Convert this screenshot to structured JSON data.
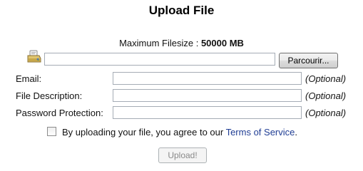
{
  "page": {
    "title": "Upload File"
  },
  "max_filesize": {
    "label": "Maximum Filesize : ",
    "value": "50000 MB"
  },
  "file_picker": {
    "icon": "file-drive-icon",
    "path_value": "",
    "browse_label": "Parcourir..."
  },
  "form": {
    "email": {
      "label": "Email:",
      "value": "",
      "hint": "(Optional)"
    },
    "description": {
      "label": "File Description:",
      "value": "",
      "hint": "(Optional)"
    },
    "password": {
      "label": "Password Protection:",
      "value": "",
      "hint": "(Optional)"
    }
  },
  "terms": {
    "checked": false,
    "text": "By uploading your file, you agree to our ",
    "link_text": "Terms of Service",
    "suffix": ".",
    "link_color": "#1f3d94"
  },
  "upload_button": {
    "label": "Upload!",
    "disabled": true
  }
}
